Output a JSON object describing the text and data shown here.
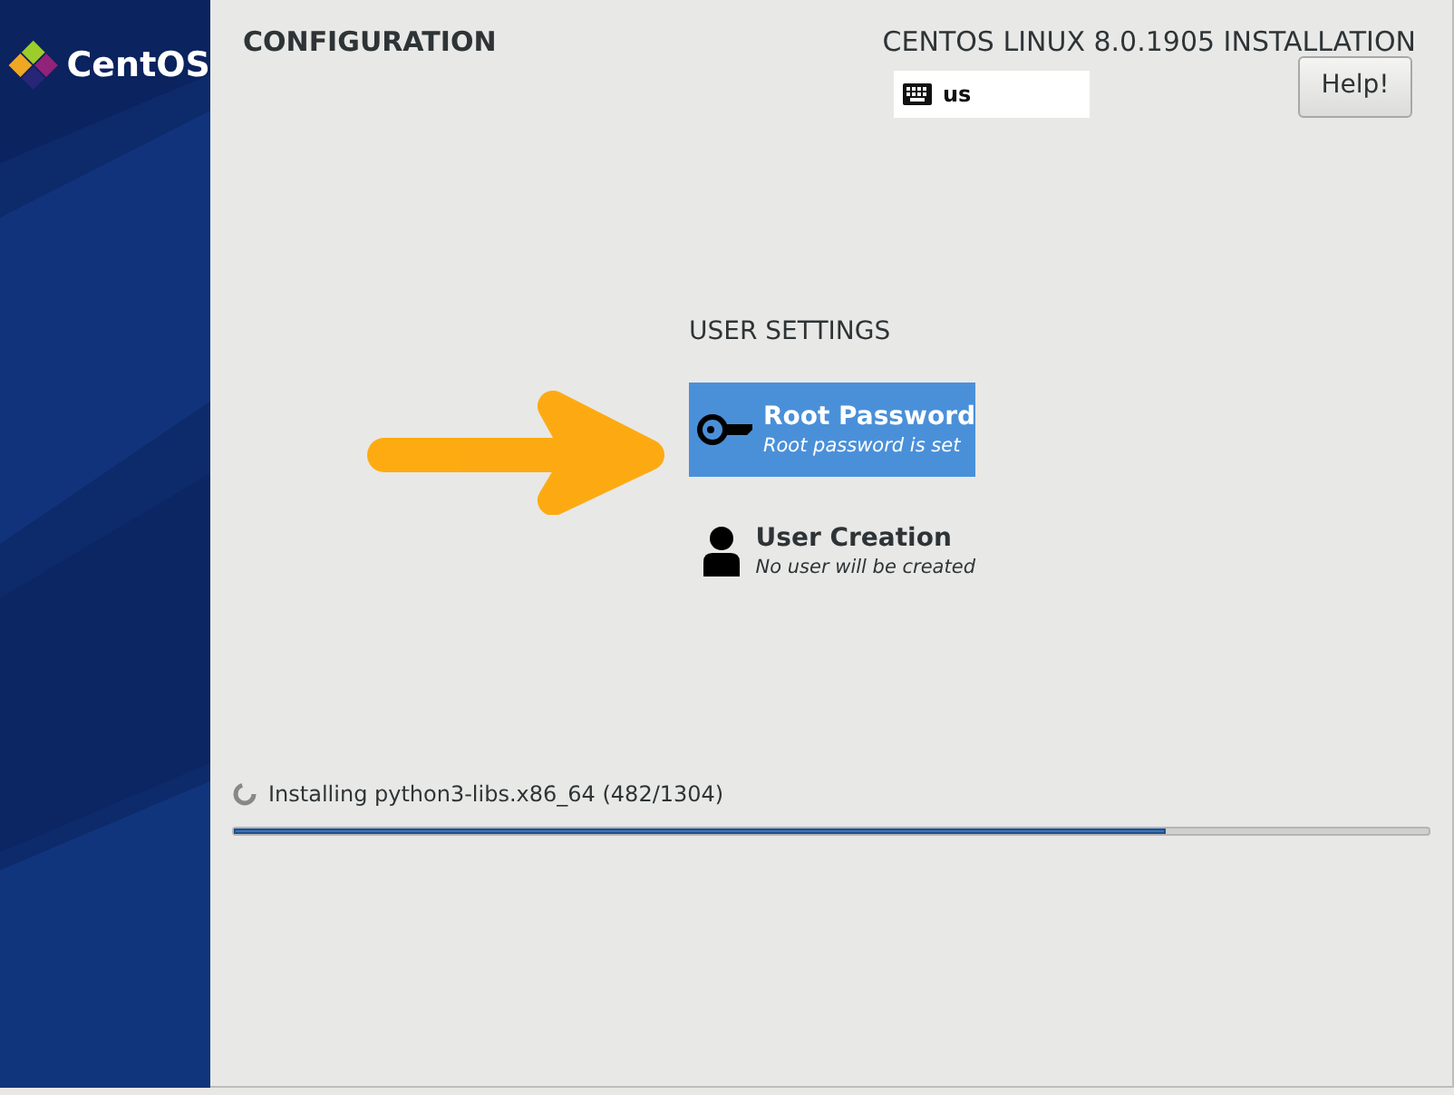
{
  "sidebar": {
    "logo_text": "CentOS"
  },
  "header": {
    "title": "CONFIGURATION",
    "product": "CENTOS LINUX 8.0.1905 INSTALLATION",
    "keyboard_layout": "us",
    "help_button": "Help!"
  },
  "user_settings": {
    "heading": "USER SETTINGS",
    "items": [
      {
        "kind": "password",
        "title": "Root Password",
        "status": "Root password is set",
        "selected": true
      },
      {
        "kind": "user",
        "title": "User Creation",
        "status": "No user will be created",
        "selected": false
      }
    ]
  },
  "progress": {
    "message": "Installing python3-libs.x86_64 (482/1304)",
    "level": 0.78
  }
}
